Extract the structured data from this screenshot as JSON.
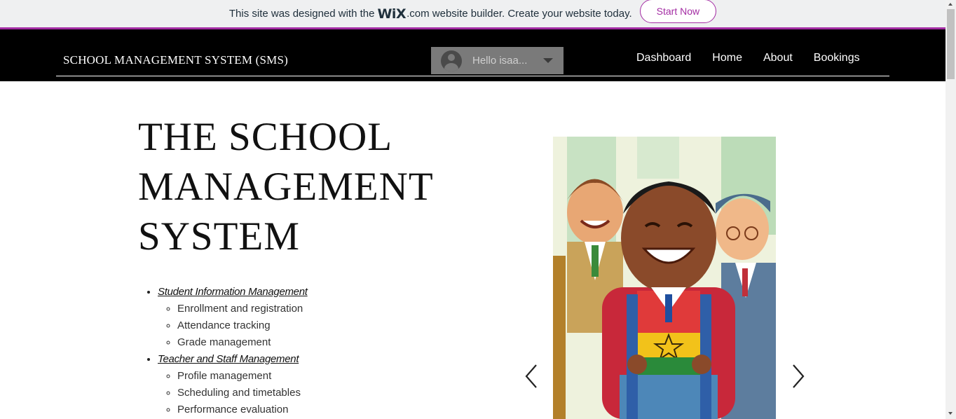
{
  "wix_banner": {
    "text_before": "This site was designed with the",
    "logo_text": "WiX",
    "text_after": ".com website builder. Create your website today.",
    "cta": "Start Now"
  },
  "header": {
    "site_title": "SCHOOL MANAGEMENT SYSTEM (SMS)",
    "login_greeting": "Hello isaa...",
    "nav": [
      "Dashboard",
      "Home",
      "About",
      "Bookings"
    ]
  },
  "hero": {
    "title_lines": [
      "THE SCHOOL",
      "MANAGEMENT",
      "SYSTEM"
    ]
  },
  "features": [
    {
      "heading": "Student Information Management",
      "items": [
        "Enrollment and registration",
        "Attendance tracking",
        "Grade management"
      ]
    },
    {
      "heading": "Teacher and Staff Management",
      "items": [
        "Profile management",
        "Scheduling and timetables",
        "Performance evaluation"
      ]
    }
  ],
  "gallery": {
    "image_icon": "cartoon-students-illustration",
    "prev_icon": "chevron-left-icon",
    "next_icon": "chevron-right-icon"
  },
  "colors": {
    "wix_accent": "#a32ca3",
    "header_bg": "#000000",
    "login_bg": "#7a7a7a"
  }
}
